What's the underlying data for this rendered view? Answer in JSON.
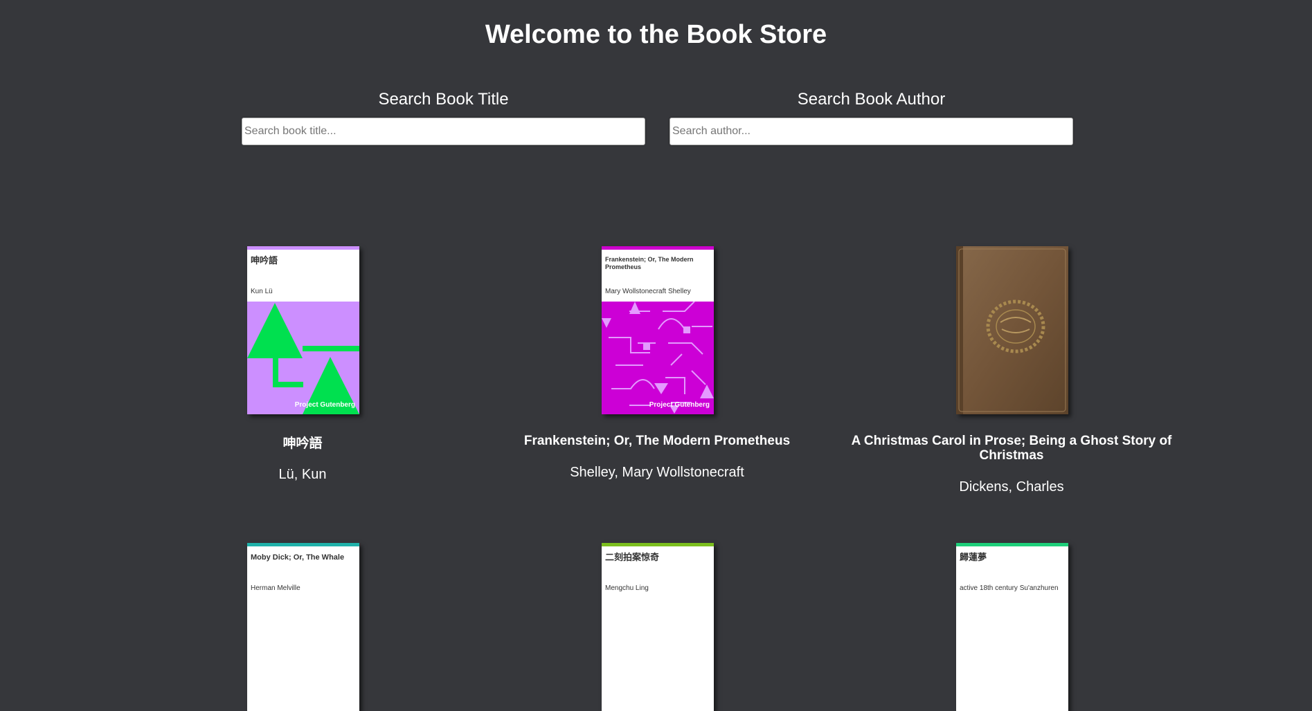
{
  "page": {
    "title": "Welcome to the Book Store"
  },
  "search": {
    "title_label": "Search Book Title",
    "title_placeholder": "Search book title...",
    "author_label": "Search Book Author",
    "author_placeholder": "Search author..."
  },
  "books": [
    {
      "title": "呻吟語",
      "author": "Lü, Kun",
      "cover": {
        "type": "gutenberg",
        "title": "呻吟語",
        "author": "Kun Lü",
        "mark": "Project Gutenberg",
        "band_color": "#cc8fff",
        "art_color": "#cc8fff",
        "shape_color": "#00e04f"
      }
    },
    {
      "title": "Frankenstein; Or, The Modern Prometheus",
      "author": "Shelley, Mary Wollstonecraft",
      "cover": {
        "type": "gutenberg",
        "title": "Frankenstein; Or, The Modern Prometheus",
        "author": "Mary Wollstonecraft Shelley",
        "mark": "Project Gutenberg",
        "band_color": "#cc00cc",
        "art_color": "#cc00d6",
        "shape_color": "#e49aff"
      }
    },
    {
      "title": "A Christmas Carol in Prose; Being a Ghost Story of Christmas",
      "author": "Dickens, Charles",
      "cover": {
        "type": "photo",
        "color": "#7a5c3e"
      }
    },
    {
      "title": "",
      "author": "",
      "cover": {
        "type": "gutenberg",
        "title": "Moby Dick; Or, The Whale",
        "author": "Herman Melville",
        "mark": "",
        "band_color": "#20b2aa"
      }
    },
    {
      "title": "",
      "author": "",
      "cover": {
        "type": "gutenberg",
        "title": "二刻拍案惊奇",
        "author": "Mengchu Ling",
        "mark": "",
        "band_color": "#7cbf1e"
      }
    },
    {
      "title": "",
      "author": "",
      "cover": {
        "type": "gutenberg",
        "title": "歸蓮夢",
        "author": "active 18th century Su'anzhuren",
        "mark": "",
        "band_color": "#1ecf7a"
      }
    }
  ]
}
